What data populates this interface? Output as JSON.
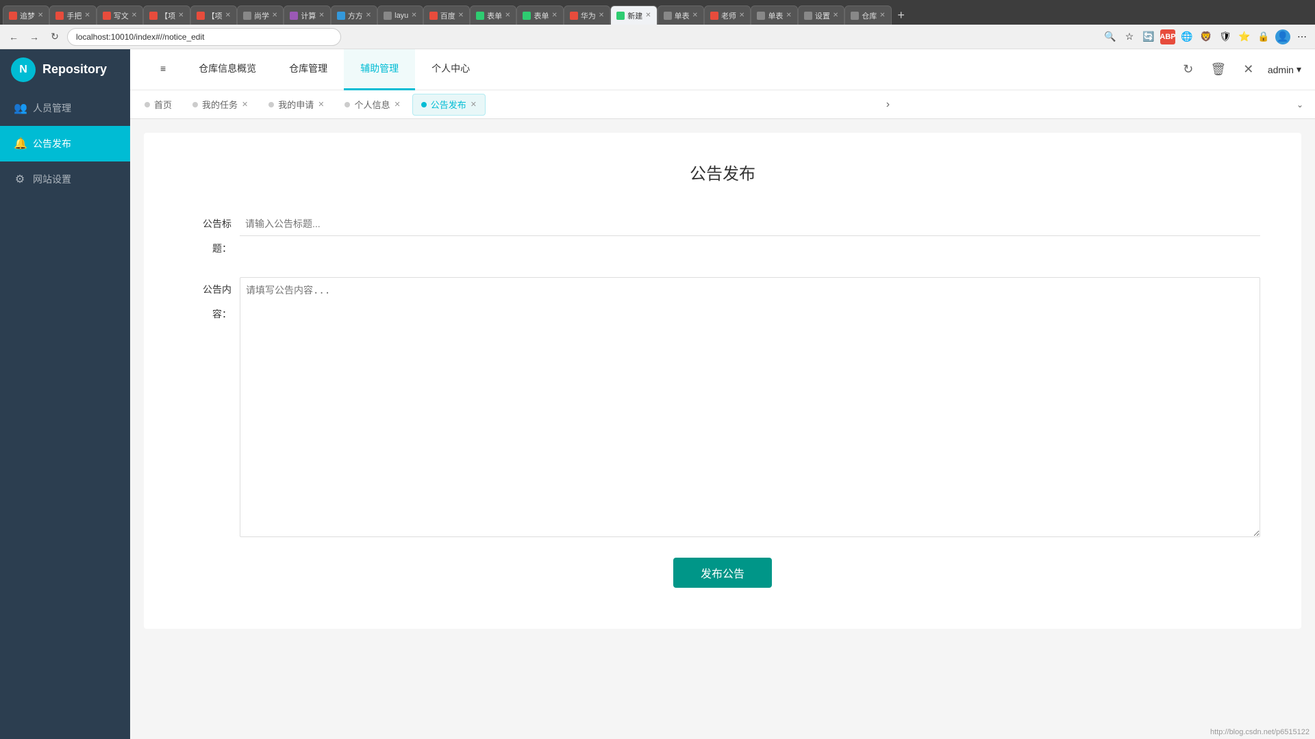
{
  "browser": {
    "url": "localhost:10010/index#//notice_edit",
    "tabs": [
      {
        "label": "追梦",
        "color": "#e74c3c",
        "active": false
      },
      {
        "label": "手把",
        "color": "#e74c3c",
        "active": false
      },
      {
        "label": "写文",
        "color": "#e74c3c",
        "active": false
      },
      {
        "label": "【项",
        "color": "#e74c3c",
        "active": false
      },
      {
        "label": "【项",
        "color": "#e74c3c",
        "active": false
      },
      {
        "label": "尚学",
        "color": "#555",
        "active": false
      },
      {
        "label": "计算",
        "color": "#9b59b6",
        "active": false
      },
      {
        "label": "方方",
        "color": "#3498db",
        "active": false
      },
      {
        "label": "layu",
        "color": "#555",
        "active": false
      },
      {
        "label": "百度",
        "color": "#e74c3c",
        "active": false
      },
      {
        "label": "表单",
        "color": "#2ecc71",
        "active": false
      },
      {
        "label": "表单",
        "color": "#2ecc71",
        "active": false
      },
      {
        "label": "华为",
        "color": "#e74c3c",
        "active": false
      },
      {
        "label": "新建",
        "color": "#2ecc71",
        "active": true
      },
      {
        "label": "单表",
        "color": "#555",
        "active": false
      },
      {
        "label": "老师",
        "color": "#e74c3c",
        "active": false
      },
      {
        "label": "单表",
        "color": "#555",
        "active": false
      },
      {
        "label": "设置",
        "color": "#555",
        "active": false
      },
      {
        "label": "仓库",
        "color": "#555",
        "active": false
      }
    ]
  },
  "logo": {
    "icon_text": "N",
    "title": "Repository"
  },
  "nav_menus": [
    {
      "label": "≡",
      "key": "menu-icon"
    },
    {
      "label": "仓库信息概览",
      "key": "warehouse-overview"
    },
    {
      "label": "仓库管理",
      "key": "warehouse-management"
    },
    {
      "label": "辅助管理",
      "key": "auxiliary-management",
      "active": true
    },
    {
      "label": "个人中心",
      "key": "personal-center"
    }
  ],
  "top_right": {
    "refresh_label": "↻",
    "delete_label": "🗑",
    "close_label": "✕",
    "admin_label": "admin",
    "dropdown_label": "▾"
  },
  "sidebar": {
    "items": [
      {
        "icon": "👥",
        "label": "人员管理",
        "key": "user-management",
        "active": false
      },
      {
        "icon": "🔔",
        "label": "公告发布",
        "key": "announcement",
        "active": true
      },
      {
        "icon": "⚙",
        "label": "网站设置",
        "key": "site-settings",
        "active": false
      }
    ]
  },
  "tabs": [
    {
      "label": "首页",
      "key": "home",
      "active": false,
      "closable": false
    },
    {
      "label": "我的任务",
      "key": "my-tasks",
      "active": false,
      "closable": true
    },
    {
      "label": "我的申请",
      "key": "my-apply",
      "active": false,
      "closable": true
    },
    {
      "label": "个人信息",
      "key": "personal-info",
      "active": false,
      "closable": true
    },
    {
      "label": "公告发布",
      "key": "announcement",
      "active": true,
      "closable": true
    }
  ],
  "form": {
    "title": "公告发布",
    "title_label": "公告标题：",
    "title_placeholder": "请输入公告标题...",
    "content_label": "公告内容：",
    "content_placeholder": "请填写公告内容...",
    "submit_label": "发布公告"
  },
  "footer": {
    "hint": "http://blog.csdn.net/p6515122"
  }
}
